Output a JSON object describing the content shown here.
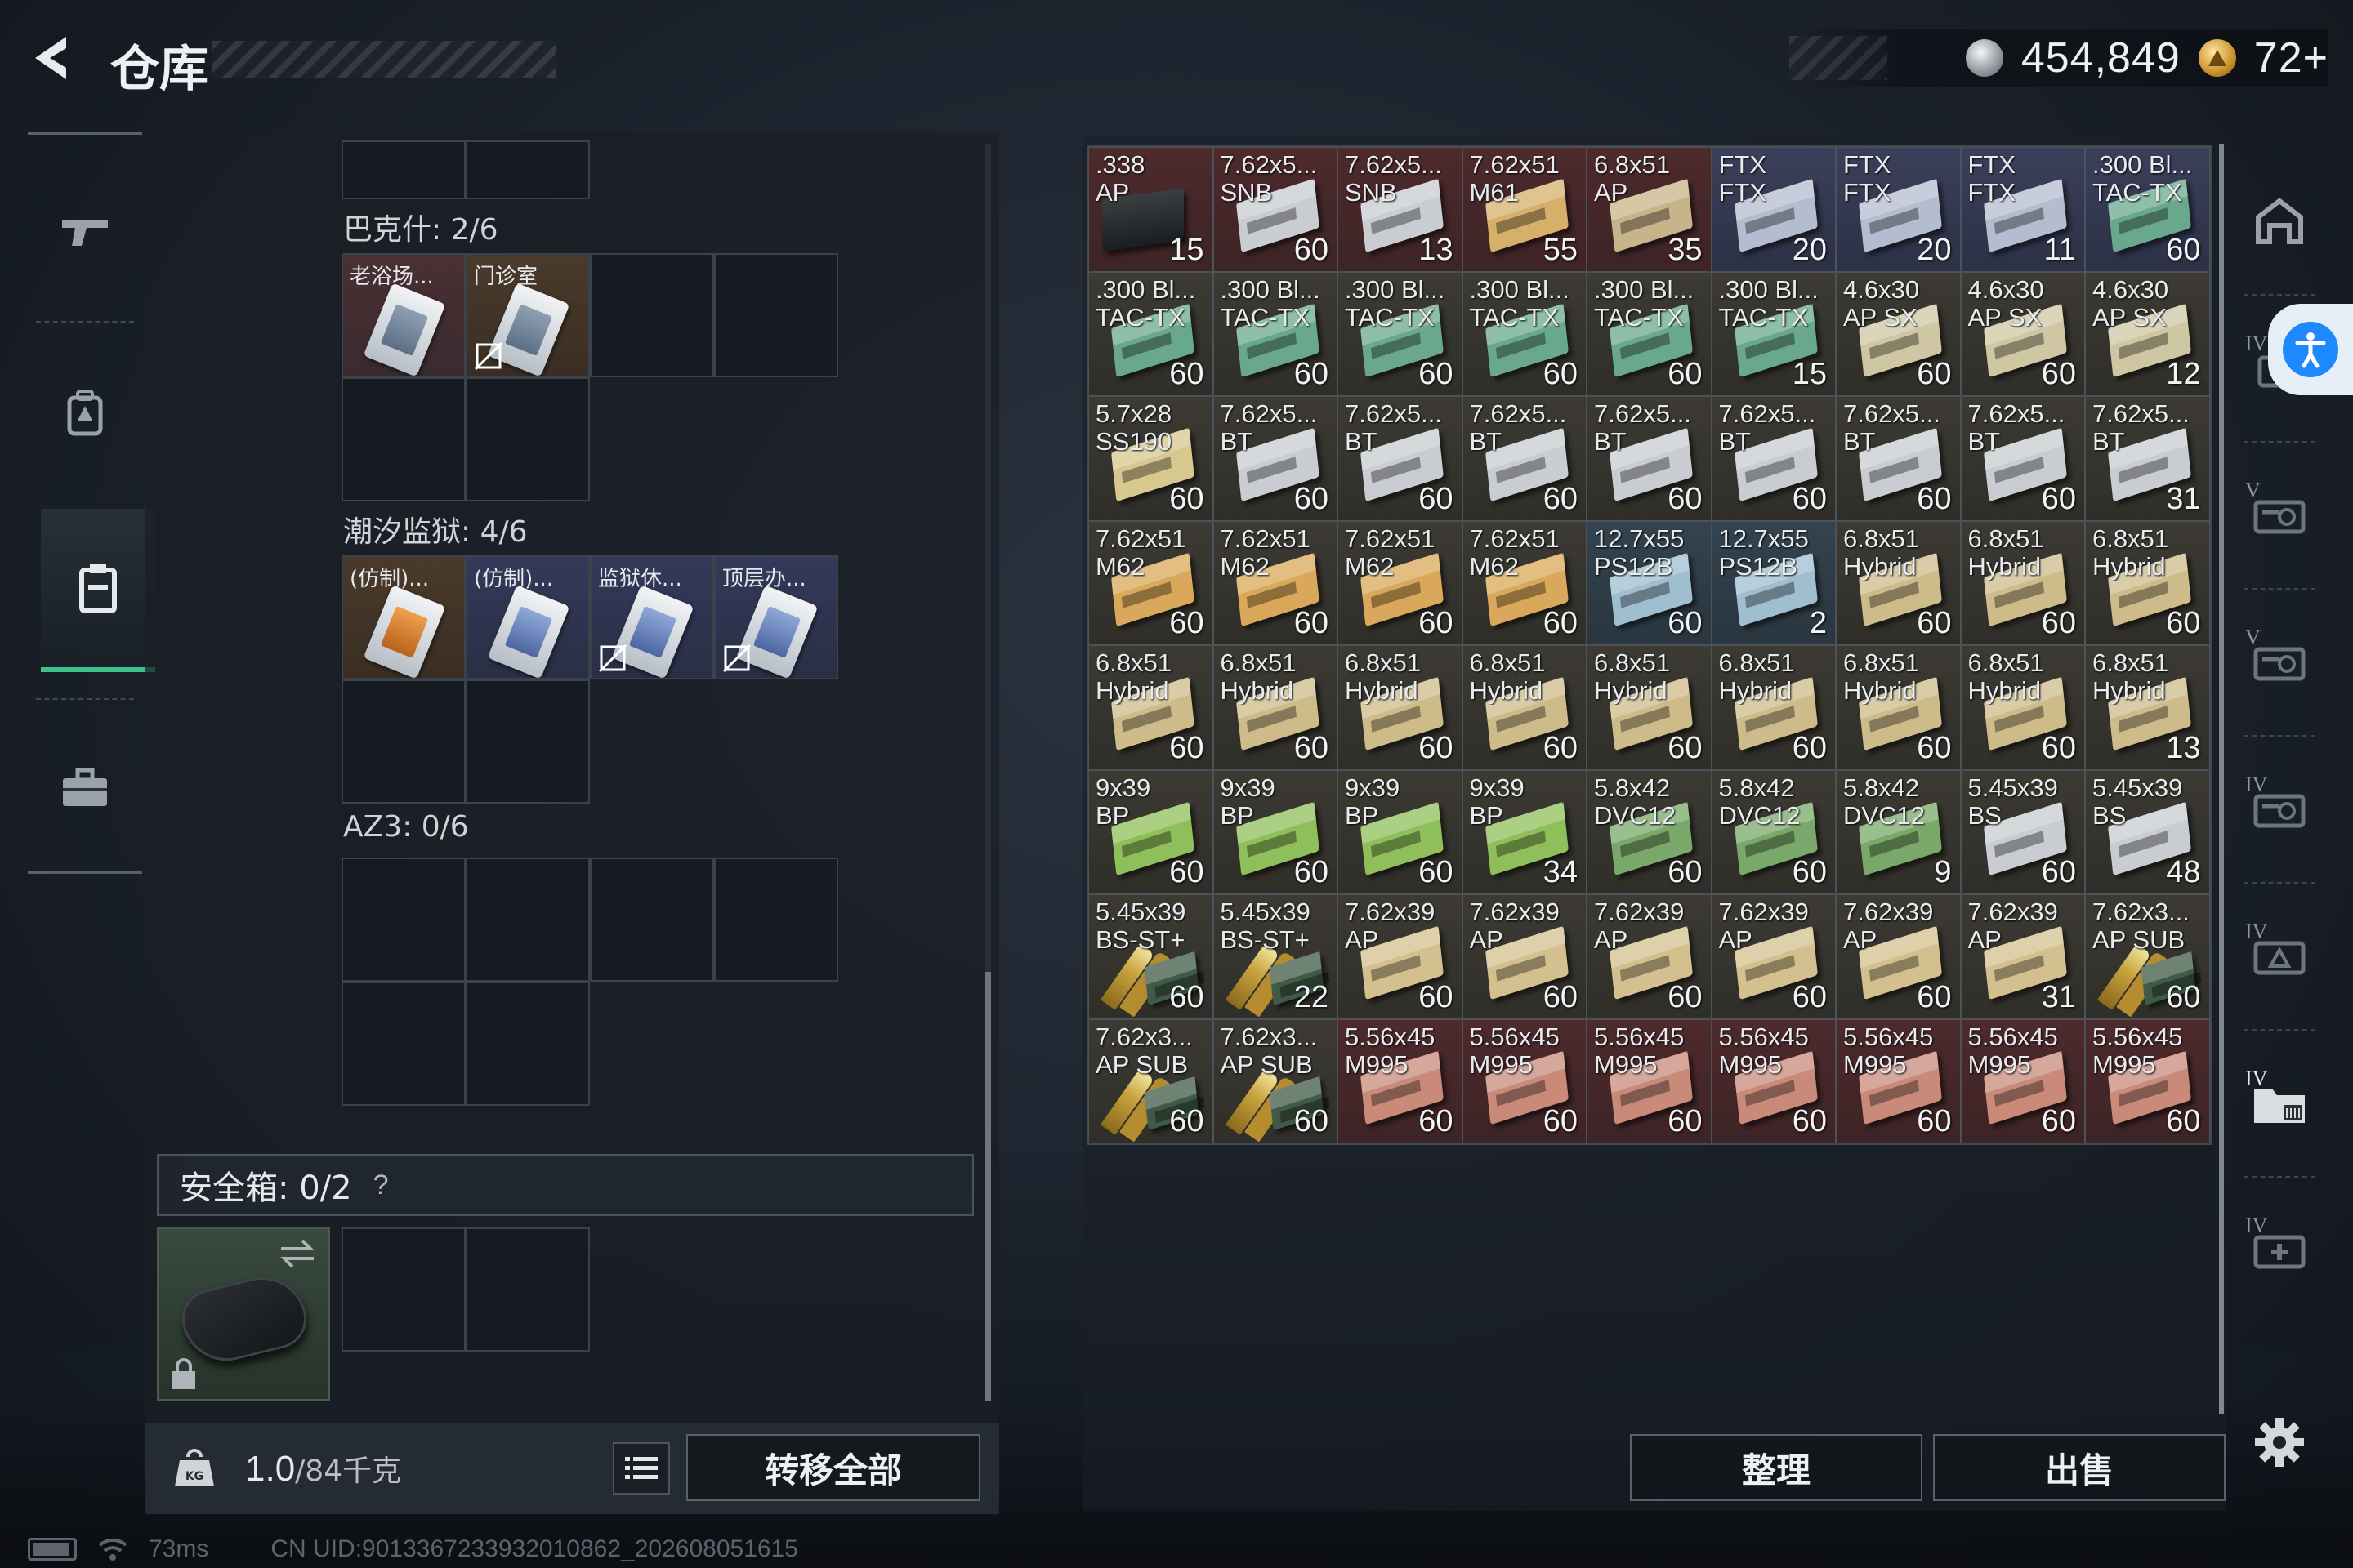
{
  "header": {
    "title": "仓库",
    "silver_amount": "454,849",
    "gold_amount": "72+"
  },
  "left_nav": [
    {
      "icon": "gun-icon"
    },
    {
      "icon": "backpack-icon"
    },
    {
      "icon": "chest-rig-icon",
      "active": true
    },
    {
      "icon": "briefcase-icon"
    }
  ],
  "key_sections": [
    {
      "label": "巴克什: 2/6",
      "keys": [
        "老浴场...",
        "门诊室"
      ]
    },
    {
      "label": "潮汐监狱: 4/6",
      "keys": [
        "(仿制)...",
        "(仿制)...",
        "监狱休...",
        "顶层办..."
      ]
    },
    {
      "label": "AZ3: 0/6",
      "keys": []
    }
  ],
  "safe_box": {
    "label": "安全箱: 0/2",
    "help": "?"
  },
  "bottom_bar": {
    "weight": "1.0",
    "weight_max": "/84千克",
    "transfer_all": "转移全部"
  },
  "status": {
    "ping": "73ms",
    "uid": "CN UID:9013367233932010862_202608051615"
  },
  "inventory": [
    {
      "name": ".338\nAP",
      "count": "15",
      "tint": "red",
      "kind": "case"
    },
    {
      "name": "7.62x5...\nSNB",
      "count": "60",
      "tint": "red",
      "kind": "box",
      "color": "#c9ccd0"
    },
    {
      "name": "7.62x5...\nSNB",
      "count": "13",
      "tint": "red",
      "kind": "box",
      "color": "#c9ccd0"
    },
    {
      "name": "7.62x51\nM61",
      "count": "55",
      "tint": "red",
      "kind": "box",
      "color": "#d6b06a"
    },
    {
      "name": "6.8x51\nAP",
      "count": "35",
      "tint": "red",
      "kind": "box",
      "color": "#c8b48a"
    },
    {
      "name": "FTX\nFTX",
      "count": "20",
      "tint": "purple",
      "kind": "box",
      "color": "#b4bccf"
    },
    {
      "name": "FTX\nFTX",
      "count": "20",
      "tint": "purple",
      "kind": "box",
      "color": "#b4bccf"
    },
    {
      "name": "FTX\nFTX",
      "count": "11",
      "tint": "purple",
      "kind": "box",
      "color": "#b4bccf"
    },
    {
      "name": ".300 Bl...\nTAC-TX",
      "count": "60",
      "tint": "purple",
      "kind": "box",
      "color": "#6aa88e"
    },
    {
      "name": ".300 Bl...\nTAC-TX",
      "count": "60",
      "tint": "normal",
      "kind": "box",
      "color": "#6aa88e"
    },
    {
      "name": ".300 Bl...\nTAC-TX",
      "count": "60",
      "tint": "normal",
      "kind": "box",
      "color": "#6aa88e"
    },
    {
      "name": ".300 Bl...\nTAC-TX",
      "count": "60",
      "tint": "normal",
      "kind": "box",
      "color": "#6aa88e"
    },
    {
      "name": ".300 Bl...\nTAC-TX",
      "count": "60",
      "tint": "normal",
      "kind": "box",
      "color": "#6aa88e"
    },
    {
      "name": ".300 Bl...\nTAC-TX",
      "count": "60",
      "tint": "normal",
      "kind": "box",
      "color": "#6aa88e"
    },
    {
      "name": ".300 Bl...\nTAC-TX",
      "count": "15",
      "tint": "normal",
      "kind": "box",
      "color": "#6aa88e"
    },
    {
      "name": "4.6x30\nAP SX",
      "count": "60",
      "tint": "normal",
      "kind": "box",
      "color": "#cfc7a4"
    },
    {
      "name": "4.6x30\nAP SX",
      "count": "60",
      "tint": "normal",
      "kind": "box",
      "color": "#cfc7a4"
    },
    {
      "name": "4.6x30\nAP SX",
      "count": "12",
      "tint": "normal",
      "kind": "box",
      "color": "#cfc7a4"
    },
    {
      "name": "5.7x28\nSS190",
      "count": "60",
      "tint": "normal",
      "kind": "box",
      "color": "#d7c88f"
    },
    {
      "name": "7.62x5...\nBT",
      "count": "60",
      "tint": "normal",
      "kind": "box",
      "color": "#c9ccd0"
    },
    {
      "name": "7.62x5...\nBT",
      "count": "60",
      "tint": "normal",
      "kind": "box",
      "color": "#c9ccd0"
    },
    {
      "name": "7.62x5...\nBT",
      "count": "60",
      "tint": "normal",
      "kind": "box",
      "color": "#c9ccd0"
    },
    {
      "name": "7.62x5...\nBT",
      "count": "60",
      "tint": "normal",
      "kind": "box",
      "color": "#c9ccd0"
    },
    {
      "name": "7.62x5...\nBT",
      "count": "60",
      "tint": "normal",
      "kind": "box",
      "color": "#c9ccd0"
    },
    {
      "name": "7.62x5...\nBT",
      "count": "60",
      "tint": "normal",
      "kind": "box",
      "color": "#c9ccd0"
    },
    {
      "name": "7.62x5...\nBT",
      "count": "60",
      "tint": "normal",
      "kind": "box",
      "color": "#c9ccd0"
    },
    {
      "name": "7.62x5...\nBT",
      "count": "31",
      "tint": "normal",
      "kind": "box",
      "color": "#c9ccd0"
    },
    {
      "name": "7.62x51\nM62",
      "count": "60",
      "tint": "normal",
      "kind": "box",
      "color": "#d9a85a"
    },
    {
      "name": "7.62x51\nM62",
      "count": "60",
      "tint": "normal",
      "kind": "box",
      "color": "#d9a85a"
    },
    {
      "name": "7.62x51\nM62",
      "count": "60",
      "tint": "normal",
      "kind": "box",
      "color": "#d9a85a"
    },
    {
      "name": "7.62x51\nM62",
      "count": "60",
      "tint": "normal",
      "kind": "box",
      "color": "#d9a85a"
    },
    {
      "name": "12.7x55\nPS12B",
      "count": "60",
      "tint": "blue",
      "kind": "box",
      "color": "#9fbfd1"
    },
    {
      "name": "12.7x55\nPS12B",
      "count": "2",
      "tint": "blue",
      "kind": "box",
      "color": "#9fbfd1"
    },
    {
      "name": "6.8x51\nHybrid",
      "count": "60",
      "tint": "normal",
      "kind": "box",
      "color": "#cdbb8a"
    },
    {
      "name": "6.8x51\nHybrid",
      "count": "60",
      "tint": "normal",
      "kind": "box",
      "color": "#cdbb8a"
    },
    {
      "name": "6.8x51\nHybrid",
      "count": "60",
      "tint": "normal",
      "kind": "box",
      "color": "#cdbb8a"
    },
    {
      "name": "6.8x51\nHybrid",
      "count": "60",
      "tint": "normal",
      "kind": "box",
      "color": "#cdbb8a"
    },
    {
      "name": "6.8x51\nHybrid",
      "count": "60",
      "tint": "normal",
      "kind": "box",
      "color": "#cdbb8a"
    },
    {
      "name": "6.8x51\nHybrid",
      "count": "60",
      "tint": "normal",
      "kind": "box",
      "color": "#cdbb8a"
    },
    {
      "name": "6.8x51\nHybrid",
      "count": "60",
      "tint": "normal",
      "kind": "box",
      "color": "#cdbb8a"
    },
    {
      "name": "6.8x51\nHybrid",
      "count": "60",
      "tint": "normal",
      "kind": "box",
      "color": "#cdbb8a"
    },
    {
      "name": "6.8x51\nHybrid",
      "count": "60",
      "tint": "normal",
      "kind": "box",
      "color": "#cdbb8a"
    },
    {
      "name": "6.8x51\nHybrid",
      "count": "60",
      "tint": "normal",
      "kind": "box",
      "color": "#cdbb8a"
    },
    {
      "name": "6.8x51\nHybrid",
      "count": "60",
      "tint": "normal",
      "kind": "box",
      "color": "#cdbb8a"
    },
    {
      "name": "6.8x51\nHybrid",
      "count": "13",
      "tint": "normal",
      "kind": "box",
      "color": "#cdbb8a"
    },
    {
      "name": "9x39\nBP",
      "count": "60",
      "tint": "normal",
      "kind": "box",
      "color": "#8fbf5a"
    },
    {
      "name": "9x39\nBP",
      "count": "60",
      "tint": "normal",
      "kind": "box",
      "color": "#8fbf5a"
    },
    {
      "name": "9x39\nBP",
      "count": "60",
      "tint": "normal",
      "kind": "box",
      "color": "#8fbf5a"
    },
    {
      "name": "9x39\nBP",
      "count": "34",
      "tint": "normal",
      "kind": "box",
      "color": "#8fbf5a"
    },
    {
      "name": "5.8x42\nDVC12",
      "count": "60",
      "tint": "normal",
      "kind": "box",
      "color": "#7aa86a"
    },
    {
      "name": "5.8x42\nDVC12",
      "count": "60",
      "tint": "normal",
      "kind": "box",
      "color": "#7aa86a"
    },
    {
      "name": "5.8x42\nDVC12",
      "count": "9",
      "tint": "normal",
      "kind": "box",
      "color": "#7aa86a"
    },
    {
      "name": "5.45x39\nBS",
      "count": "60",
      "tint": "normal",
      "kind": "box",
      "color": "#c9ccd0"
    },
    {
      "name": "5.45x39\nBS",
      "count": "48",
      "tint": "normal",
      "kind": "box",
      "color": "#c9ccd0"
    },
    {
      "name": "5.45x39\nBS-ST+",
      "count": "60",
      "tint": "normal",
      "kind": "rounds"
    },
    {
      "name": "5.45x39\nBS-ST+",
      "count": "22",
      "tint": "normal",
      "kind": "rounds"
    },
    {
      "name": "7.62x39\nAP",
      "count": "60",
      "tint": "normal",
      "kind": "box",
      "color": "#d3c08e"
    },
    {
      "name": "7.62x39\nAP",
      "count": "60",
      "tint": "normal",
      "kind": "box",
      "color": "#d3c08e"
    },
    {
      "name": "7.62x39\nAP",
      "count": "60",
      "tint": "normal",
      "kind": "box",
      "color": "#d3c08e"
    },
    {
      "name": "7.62x39\nAP",
      "count": "60",
      "tint": "normal",
      "kind": "box",
      "color": "#d3c08e"
    },
    {
      "name": "7.62x39\nAP",
      "count": "60",
      "tint": "normal",
      "kind": "box",
      "color": "#d3c08e"
    },
    {
      "name": "7.62x39\nAP",
      "count": "31",
      "tint": "normal",
      "kind": "box",
      "color": "#d3c08e"
    },
    {
      "name": "7.62x3...\nAP SUB",
      "count": "60",
      "tint": "normal",
      "kind": "rounds"
    },
    {
      "name": "7.62x3...\nAP SUB",
      "count": "60",
      "tint": "normal",
      "kind": "rounds"
    },
    {
      "name": "7.62x3...\nAP SUB",
      "count": "60",
      "tint": "normal",
      "kind": "rounds"
    },
    {
      "name": "5.56x45\nM995",
      "count": "60",
      "tint": "red",
      "kind": "box",
      "color": "#c98a7a"
    },
    {
      "name": "5.56x45\nM995",
      "count": "60",
      "tint": "red",
      "kind": "box",
      "color": "#c98a7a"
    },
    {
      "name": "5.56x45\nM995",
      "count": "60",
      "tint": "red",
      "kind": "box",
      "color": "#c98a7a"
    },
    {
      "name": "5.56x45\nM995",
      "count": "60",
      "tint": "red",
      "kind": "box",
      "color": "#c98a7a"
    },
    {
      "name": "5.56x45\nM995",
      "count": "60",
      "tint": "red",
      "kind": "box",
      "color": "#c98a7a"
    },
    {
      "name": "5.56x45\nM995",
      "count": "60",
      "tint": "red",
      "kind": "box",
      "color": "#c98a7a"
    },
    {
      "name": "5.56x45\nM995",
      "count": "60",
      "tint": "red",
      "kind": "box",
      "color": "#c98a7a"
    }
  ],
  "right_nav": [
    {
      "icon": "hideout-icon",
      "roman": ""
    },
    {
      "icon": "case-icon",
      "roman": "IV"
    },
    {
      "icon": "weapon-case-icon",
      "roman": "V"
    },
    {
      "icon": "weapon-case-icon",
      "roman": "V"
    },
    {
      "icon": "weapon-case-icon",
      "roman": "IV"
    },
    {
      "icon": "ammo-case-icon",
      "roman": "IV"
    },
    {
      "icon": "folder-icon",
      "roman": "IV",
      "active": true
    },
    {
      "icon": "medical-case-icon",
      "roman": "IV"
    }
  ],
  "actions": {
    "sort": "整理",
    "sell": "出售"
  },
  "colors": {
    "accent_green": "#3fbf8a",
    "access_blue": "#1e88ff"
  }
}
